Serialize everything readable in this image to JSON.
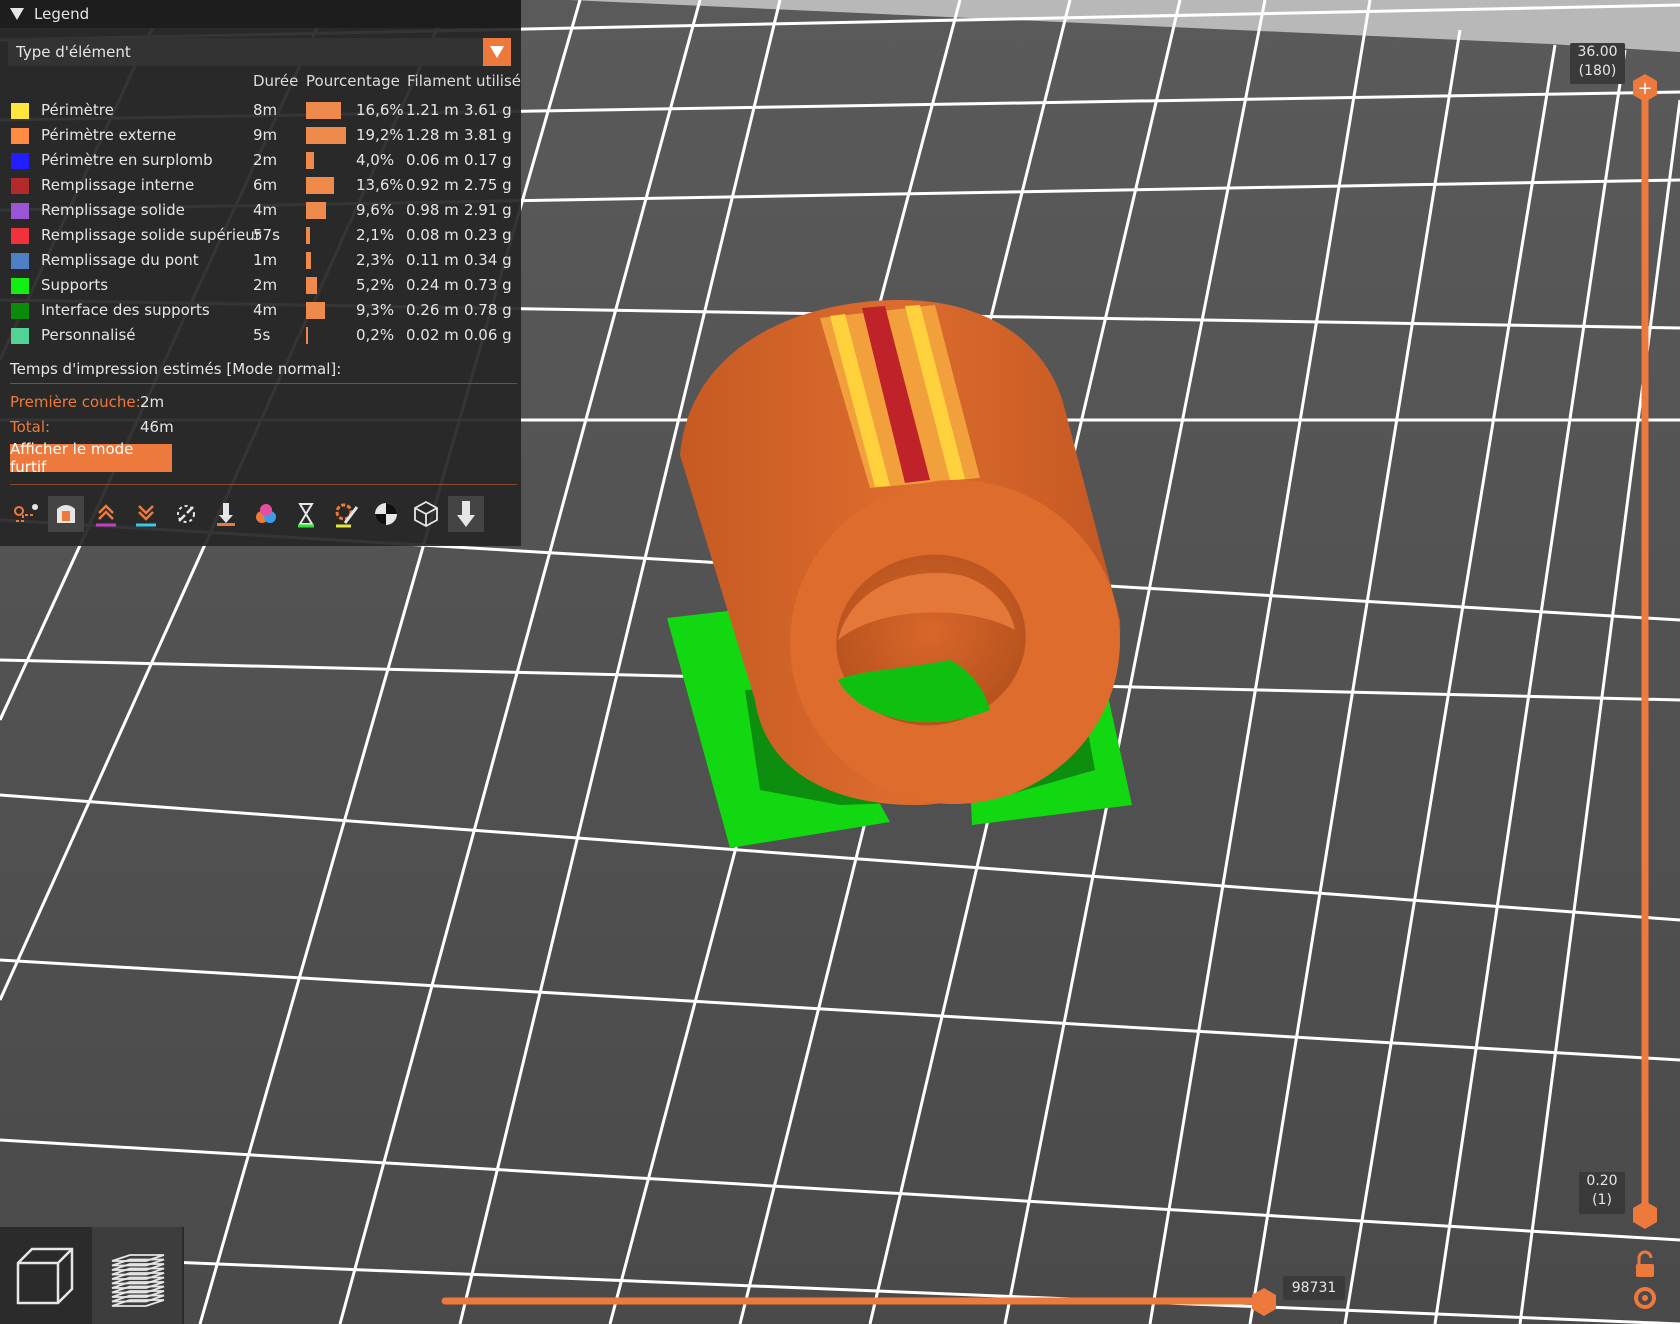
{
  "legend": {
    "title": "Legend",
    "view_type": "Type d'élément",
    "columns": {
      "duration": "Durée",
      "percentage": "Pourcentage",
      "filament": "Filament utilisé"
    },
    "rows": [
      {
        "color": "#ffe63c",
        "name": "Périmètre",
        "duration": "8m",
        "percent_value": 16.6,
        "percent": "16,6%",
        "length": "1.21 m",
        "weight": "3.61 g"
      },
      {
        "color": "#ff8c40",
        "name": "Périmètre externe",
        "duration": "9m",
        "percent_value": 19.2,
        "percent": "19,2%",
        "length": "1.28 m",
        "weight": "3.81 g"
      },
      {
        "color": "#1f1fff",
        "name": "Périmètre en surplomb",
        "duration": "2m",
        "percent_value": 4.0,
        "percent": "4,0%",
        "length": "0.06 m",
        "weight": "0.17 g"
      },
      {
        "color": "#b22a2a",
        "name": "Remplissage interne",
        "duration": "6m",
        "percent_value": 13.6,
        "percent": "13,6%",
        "length": "0.92 m",
        "weight": "2.75 g"
      },
      {
        "color": "#9a55d6",
        "name": "Remplissage solide",
        "duration": "4m",
        "percent_value": 9.6,
        "percent": "9,6%",
        "length": "0.98 m",
        "weight": "2.91 g"
      },
      {
        "color": "#f0323c",
        "name": "Remplissage solide supérieur",
        "duration": "57s",
        "percent_value": 2.1,
        "percent": "2,1%",
        "length": "0.08 m",
        "weight": "0.23 g"
      },
      {
        "color": "#4f7fc4",
        "name": "Remplissage du pont",
        "duration": "1m",
        "percent_value": 2.3,
        "percent": "2,3%",
        "length": "0.11 m",
        "weight": "0.34 g"
      },
      {
        "color": "#12f012",
        "name": "Supports",
        "duration": "2m",
        "percent_value": 5.2,
        "percent": "5,2%",
        "length": "0.24 m",
        "weight": "0.73 g"
      },
      {
        "color": "#0b8a0b",
        "name": "Interface des supports",
        "duration": "4m",
        "percent_value": 9.3,
        "percent": "9,3%",
        "length": "0.26 m",
        "weight": "0.78 g"
      },
      {
        "color": "#52d295",
        "name": "Personnalisé",
        "duration": "5s",
        "percent_value": 0.2,
        "percent": "0,2%",
        "length": "0.02 m",
        "weight": "0.06 g"
      }
    ],
    "estimate_title": "Temps d'impression estimés [Mode normal]:",
    "first_layer_label": "Première couche:",
    "first_layer_value": "2m",
    "total_label": "Total:",
    "total_value": "46m",
    "stealth_button": "Afficher le mode furtif"
  },
  "toolbar_icons": [
    "travel-icon",
    "wipe-icon",
    "retractions-icon",
    "deretractions-icon",
    "seams-icon",
    "tool-changes-icon",
    "color-changes-icon",
    "pause-prints-icon",
    "custom-gcodes-icon",
    "center-of-gravity-icon",
    "shells-icon",
    "tool-marker-icon"
  ],
  "vertical_slider": {
    "top_value": "36.00",
    "top_layer": "(180)",
    "bottom_value": "0.20",
    "bottom_layer": "(1)",
    "top_fraction": 1.0,
    "bottom_fraction": 0.0
  },
  "horizontal_slider": {
    "value": "98731",
    "fraction": 1.0
  },
  "view_buttons": [
    "3d-view-icon",
    "preview-layers-icon"
  ],
  "colors": {
    "accent": "#ed7a3c",
    "bed": "#525252",
    "grid": "#ffffff",
    "model": "#d9692c",
    "support": "#12e012"
  }
}
